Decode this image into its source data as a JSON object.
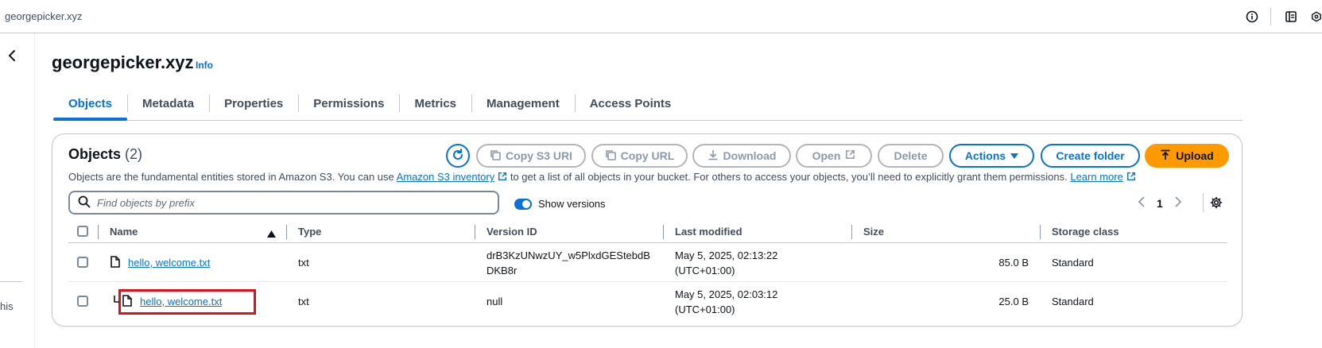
{
  "topbar": {
    "bucket_crumb": "georgepicker.xyz",
    "icons": [
      "info-circle-icon",
      "notifications-icon",
      "settings-hex-icon"
    ]
  },
  "left_rail": {
    "clipped_text": "his"
  },
  "page": {
    "title": "georgepicker.xyz",
    "info_link": "Info"
  },
  "tabs": [
    {
      "label": "Objects",
      "active": true
    },
    {
      "label": "Metadata"
    },
    {
      "label": "Properties"
    },
    {
      "label": "Permissions"
    },
    {
      "label": "Metrics"
    },
    {
      "label": "Management"
    },
    {
      "label": "Access Points"
    }
  ],
  "objects_panel": {
    "title": "Objects",
    "count": "(2)",
    "buttons": {
      "copy_s3_uri": "Copy S3 URI",
      "copy_url": "Copy URL",
      "download": "Download",
      "open": "Open",
      "delete": "Delete",
      "actions": "Actions",
      "create_folder": "Create folder",
      "upload": "Upload"
    },
    "description": {
      "before": "Objects are the fundamental entities stored in Amazon S3. You can use ",
      "inventory_link": "Amazon S3 inventory",
      "middle": " to get a list of all objects in your bucket. For others to access your objects, you’ll need to explicitly grant them permissions. ",
      "learn_more": "Learn more"
    },
    "search_placeholder": "Find objects by prefix",
    "show_versions_label": "Show versions",
    "show_versions_on": true,
    "page_number": "1",
    "columns": [
      "Name",
      "Type",
      "Version ID",
      "Last modified",
      "Size",
      "Storage class"
    ],
    "rows": [
      {
        "name": "hello, welcome.txt",
        "type": "txt",
        "version_id_line1": "drB3KzUNwzUY_w5PlxdGEStebdB",
        "version_id_line2": "DKB8r",
        "modified_line1": "May 5, 2025, 02:13:22",
        "modified_line2": "(UTC+01:00)",
        "size": "85.0 B",
        "storage_class": "Standard"
      },
      {
        "name": "hello, welcome.txt",
        "type": "txt",
        "version_id_line1": "null",
        "version_id_line2": "",
        "modified_line1": "May 5, 2025, 02:03:12",
        "modified_line2": "(UTC+01:00)",
        "size": "25.0 B",
        "storage_class": "Standard",
        "highlighted": true
      }
    ]
  },
  "colors": {
    "accent": "#0972d3",
    "upload": "#ff9900",
    "highlight": "#e0101b"
  }
}
